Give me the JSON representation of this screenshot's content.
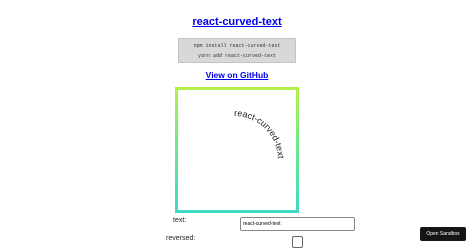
{
  "header": {
    "title": "react-curved-text",
    "install_lines": [
      "npm install react-curved-text",
      "yarn add react-curved-text"
    ],
    "github_link": "View on GitHub"
  },
  "preview": {
    "curved_text": "react-curved-text",
    "gradient_colors": [
      "#b6f049",
      "#6fe98a",
      "#3fd9c4"
    ]
  },
  "form": {
    "text_label": "text:",
    "text_value": "react-curved-text",
    "reversed_label": "reversed:",
    "reversed_checked": false
  },
  "sandbox_button": "Open Sandbox"
}
